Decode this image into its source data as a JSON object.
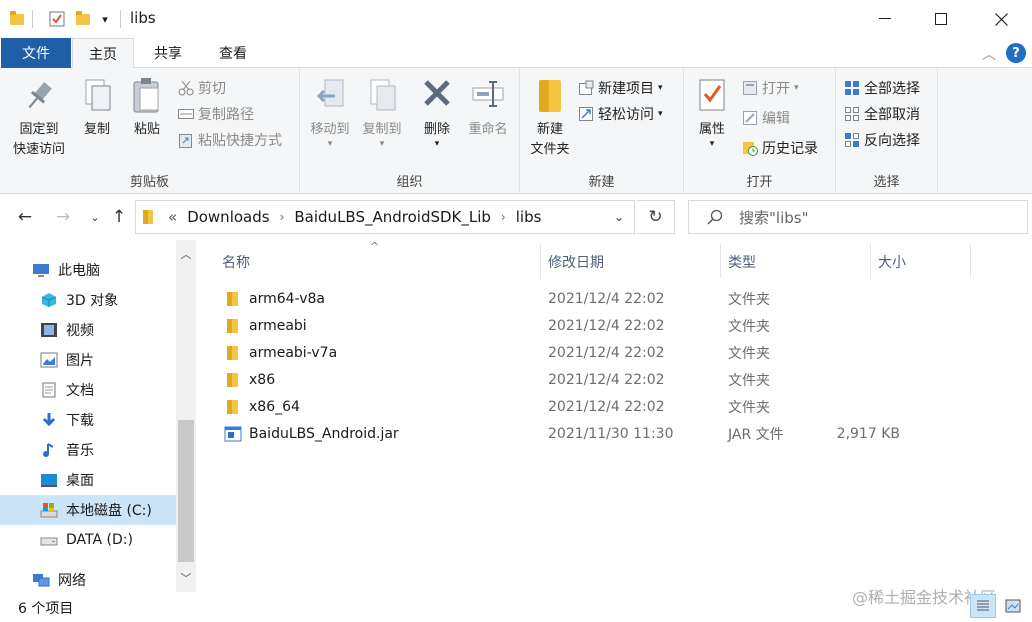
{
  "window": {
    "title": "libs"
  },
  "tabs": {
    "file": "文件",
    "home": "主页",
    "share": "共享",
    "view": "查看"
  },
  "ribbon": {
    "clipboard": {
      "label": "剪贴板",
      "pin_line1": "固定到",
      "pin_line2": "快速访问",
      "copy": "复制",
      "paste": "粘贴",
      "cut": "剪切",
      "copy_path": "复制路径",
      "paste_shortcut": "粘贴快捷方式"
    },
    "organize": {
      "label": "组织",
      "move_to": "移动到",
      "copy_to": "复制到",
      "delete": "删除",
      "rename": "重命名"
    },
    "new": {
      "label": "新建",
      "new_folder_line1": "新建",
      "new_folder_line2": "文件夹",
      "new_item": "新建项目",
      "easy_access": "轻松访问"
    },
    "open": {
      "label": "打开",
      "properties": "属性",
      "open": "打开",
      "edit": "编辑",
      "history": "历史记录"
    },
    "select": {
      "label": "选择",
      "select_all": "全部选择",
      "select_none": "全部取消",
      "invert": "反向选择"
    }
  },
  "address": {
    "overflow": "«",
    "crumbs": [
      "Downloads",
      "BaiduLBS_AndroidSDK_Lib",
      "libs"
    ],
    "search_placeholder": "搜索\"libs\""
  },
  "nav_pane": {
    "items": [
      {
        "label": "此电脑",
        "icon": "computer-icon"
      },
      {
        "label": "3D 对象",
        "icon": "3d-objects-icon"
      },
      {
        "label": "视频",
        "icon": "video-icon"
      },
      {
        "label": "图片",
        "icon": "pictures-icon"
      },
      {
        "label": "文档",
        "icon": "documents-icon"
      },
      {
        "label": "下载",
        "icon": "downloads-icon"
      },
      {
        "label": "音乐",
        "icon": "music-icon"
      },
      {
        "label": "桌面",
        "icon": "desktop-icon"
      },
      {
        "label": "本地磁盘 (C:)",
        "icon": "local-disk-icon"
      },
      {
        "label": "DATA (D:)",
        "icon": "drive-icon"
      },
      {
        "label": "网络",
        "icon": "network-icon"
      }
    ],
    "selected_index": 8
  },
  "columns": {
    "name": "名称",
    "date": "修改日期",
    "type": "类型",
    "size": "大小"
  },
  "files": [
    {
      "name": "arm64-v8a",
      "date": "2021/12/4 22:02",
      "type": "文件夹",
      "size": "",
      "icon": "folder-icon"
    },
    {
      "name": "armeabi",
      "date": "2021/12/4 22:02",
      "type": "文件夹",
      "size": "",
      "icon": "folder-icon"
    },
    {
      "name": "armeabi-v7a",
      "date": "2021/12/4 22:02",
      "type": "文件夹",
      "size": "",
      "icon": "folder-icon"
    },
    {
      "name": "x86",
      "date": "2021/12/4 22:02",
      "type": "文件夹",
      "size": "",
      "icon": "folder-icon"
    },
    {
      "name": "x86_64",
      "date": "2021/12/4 22:02",
      "type": "文件夹",
      "size": "",
      "icon": "folder-icon"
    },
    {
      "name": "BaiduLBS_Android.jar",
      "date": "2021/11/30 11:30",
      "type": "JAR 文件",
      "size": "2,917 KB",
      "icon": "jar-file-icon"
    }
  ],
  "status": {
    "item_count": "6 个项目"
  },
  "watermark": "@稀土掘金技术社区",
  "colors": {
    "file_tab": "#1f5fa8",
    "selection": "#cce4f7",
    "folder": "#f4c542",
    "header_text": "#4c607a"
  }
}
